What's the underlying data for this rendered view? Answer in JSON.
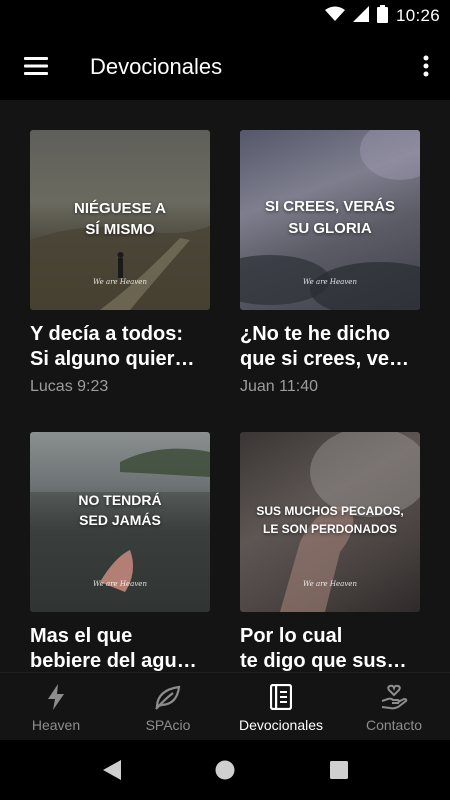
{
  "status_bar": {
    "time": "10:26",
    "icons": [
      "wifi-icon",
      "signal-icon",
      "battery-icon"
    ]
  },
  "app_bar": {
    "title": "Devocionales",
    "menu_icon": "hamburger-menu-icon",
    "more_icon": "more-vert-icon"
  },
  "cards": [
    {
      "image_text": [
        "NIÉGUESE A",
        "SÍ MISMO"
      ],
      "watermark": "We are Heaven",
      "title_lines": [
        "Y decía a todos:",
        "Si alguno quier…"
      ],
      "reference": "Lucas 9:23"
    },
    {
      "image_text": [
        "SI CREES, VERÁS",
        "SU GLORIA"
      ],
      "watermark": "We are Heaven",
      "title_lines": [
        "¿No te he dicho",
        "que si crees, ve…"
      ],
      "reference": "Juan 11:40"
    },
    {
      "image_text": [
        "NO TENDRÁ",
        "SED JAMÁS"
      ],
      "watermark": "We are Heaven",
      "title_lines": [
        "Mas el que",
        "bebiere del agu…"
      ],
      "reference": ""
    },
    {
      "image_text": [
        "SUS MUCHOS PECADOS,",
        "LE SON PERDONADOS"
      ],
      "watermark": "We are Heaven",
      "title_lines": [
        "Por lo cual",
        "te digo que sus…"
      ],
      "reference": ""
    }
  ],
  "bottom_nav": {
    "items": [
      {
        "label": "Heaven",
        "icon": "lightning-icon",
        "active": false
      },
      {
        "label": "SPAcio",
        "icon": "leaf-icon",
        "active": false
      },
      {
        "label": "Devocionales",
        "icon": "book-icon",
        "active": true
      },
      {
        "label": "Contacto",
        "icon": "hand-heart-icon",
        "active": false
      }
    ]
  },
  "colors": {
    "background": "#141414",
    "bar": "#000000",
    "inactive": "#8d8d8d",
    "active": "#ffffff",
    "reference": "#9c9c9c"
  }
}
